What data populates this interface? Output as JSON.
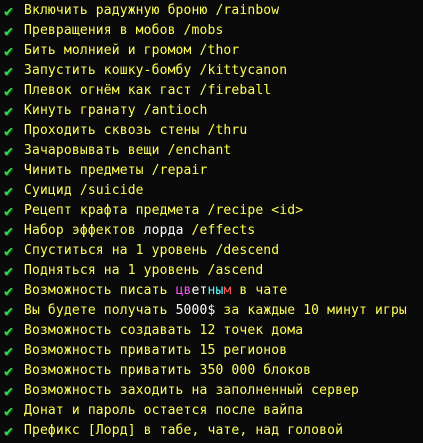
{
  "colors": {
    "check": "#2fe04a",
    "text": "#ffff55",
    "highlight_white": "#ffffff",
    "rainbow_1": "#ff55ff",
    "rainbow_2": "#55ffff",
    "rainbow_3": "#ff5555"
  },
  "items": [
    {
      "icon": "check-icon",
      "text": "Включить радужную броню /rainbow"
    },
    {
      "icon": "check-icon",
      "text": "Превращения в мобов /mobs"
    },
    {
      "icon": "check-icon",
      "text": "Бить молнией и громом /thor"
    },
    {
      "icon": "check-icon",
      "text": "Запустить кошку-бомбу /kittycanon"
    },
    {
      "icon": "check-icon",
      "text": "Плевок огнём как гаст /fireball"
    },
    {
      "icon": "check-icon",
      "text": "Кинуть гранату /antioch"
    },
    {
      "icon": "check-icon",
      "text": "Проходить сквозь стены /thru"
    },
    {
      "icon": "check-icon",
      "text": "Зачаровывать вещи /enchant"
    },
    {
      "icon": "check-icon",
      "text": "Чинить предметы /repair"
    },
    {
      "icon": "check-icon",
      "text": "Суицид /suicide"
    },
    {
      "icon": "check-icon",
      "text": "Рецепт крафта предмета /recipe <id>"
    },
    {
      "icon": "check-icon",
      "pre": "Набор эффектов ",
      "hl": "лорда",
      "post": " /effects"
    },
    {
      "icon": "check-icon",
      "text": "Спуститься на 1 уровень /descend"
    },
    {
      "icon": "check-icon",
      "text": "Подняться на 1 уровень /ascend"
    },
    {
      "icon": "check-icon",
      "pre": "Возможность писать ",
      "rainbow": [
        "цв",
        "ет",
        "ны",
        "м"
      ],
      "post": " в чате"
    },
    {
      "icon": "check-icon",
      "pre": "Вы будете получать ",
      "hl": "5000$",
      "post": " за каждые 10 минут игры"
    },
    {
      "icon": "check-icon",
      "text": "Возможность создавать 12 точек дома"
    },
    {
      "icon": "check-icon",
      "text": "Возможность приватить 15 регионов"
    },
    {
      "icon": "check-icon",
      "text": "Возможность приватить 350 000 блоков"
    },
    {
      "icon": "check-icon",
      "text": "Возможность заходить на заполненный сервер"
    },
    {
      "icon": "check-icon",
      "text": "Донат и пароль остается после вайпа"
    },
    {
      "icon": "check-icon",
      "text": "Префикс [Лорд] в табе, чате, над головой"
    }
  ]
}
